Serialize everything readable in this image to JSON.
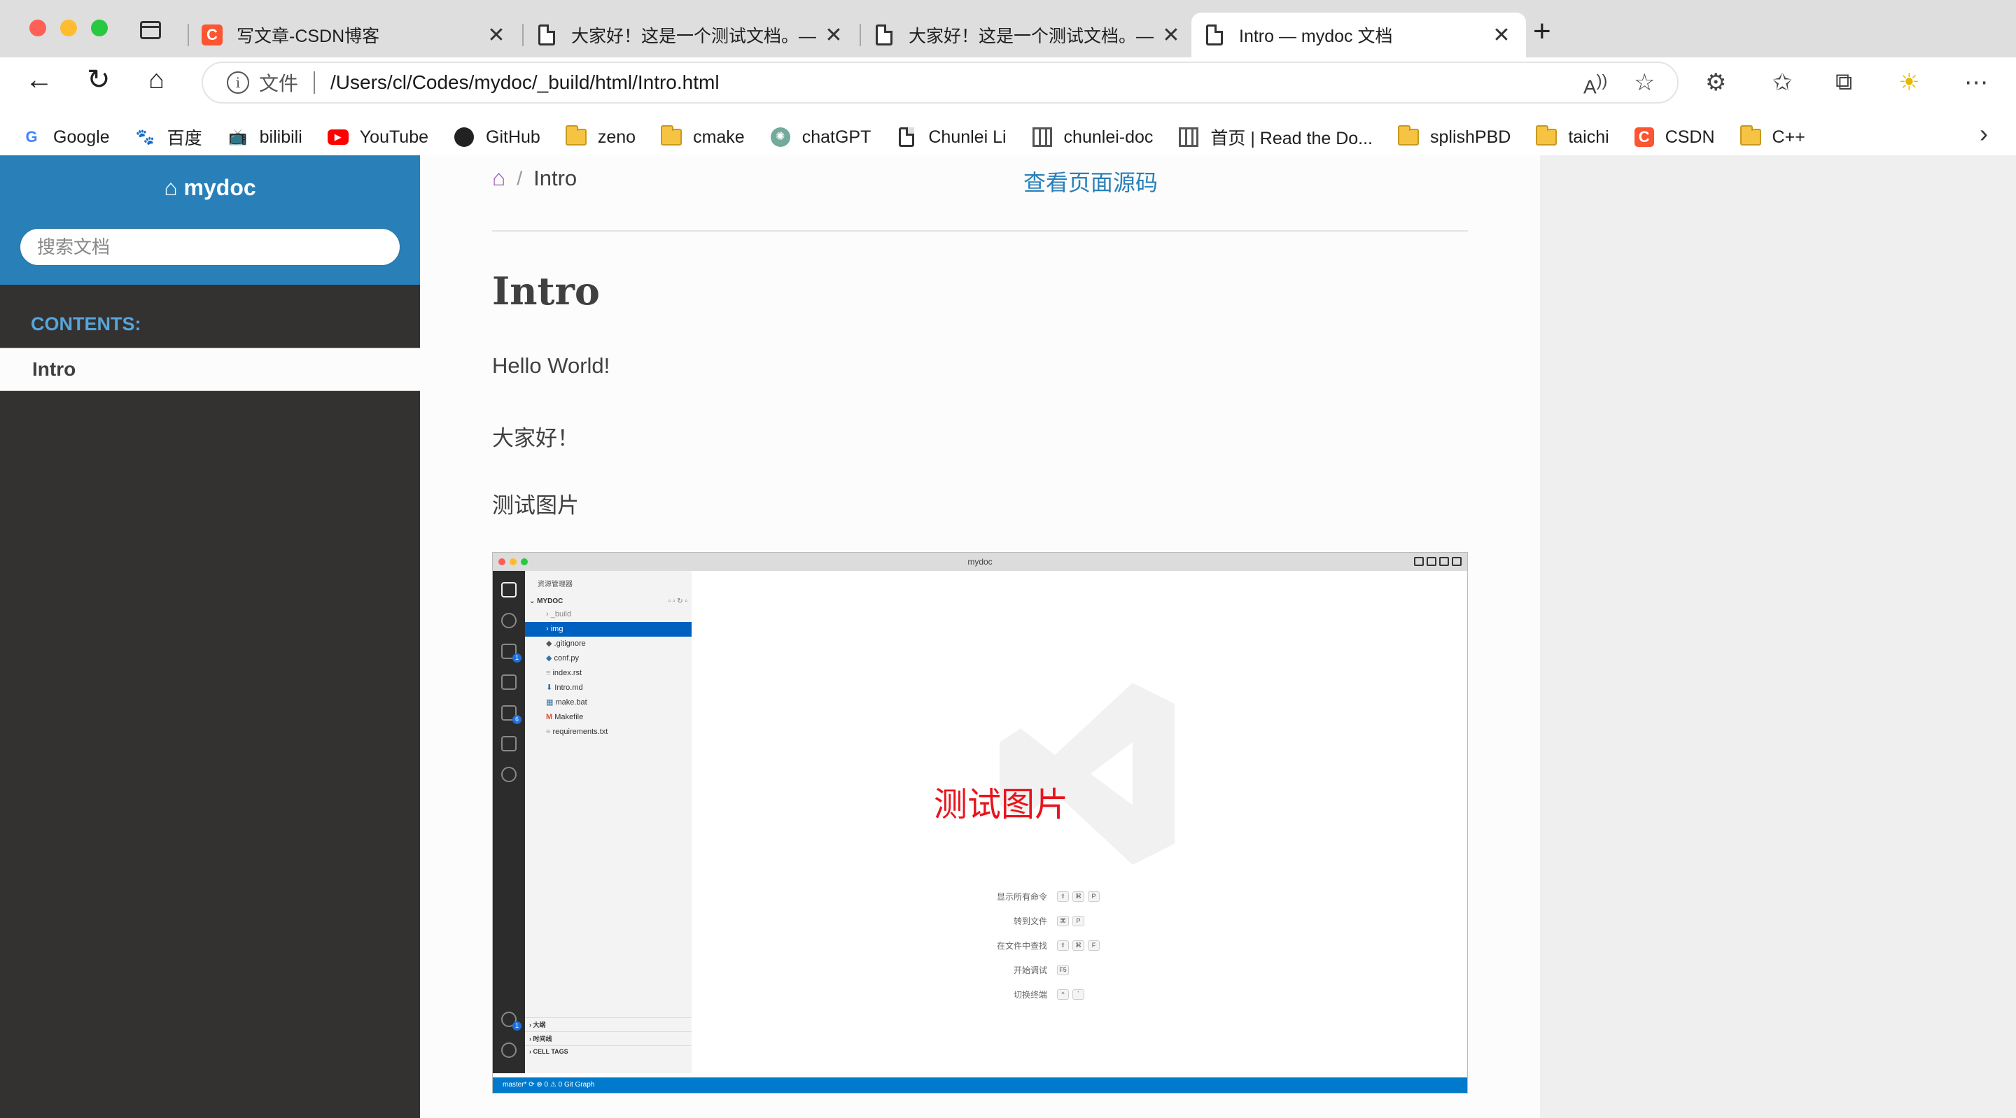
{
  "browser": {
    "tabs": [
      {
        "title": "写文章-CSDN博客",
        "favicon": "csdn-icon",
        "active": false
      },
      {
        "title": "大家好！这是一个测试文档。— ",
        "favicon": "document-icon",
        "active": false
      },
      {
        "title": "大家好！这是一个测试文档。— ",
        "favicon": "document-icon",
        "active": false
      },
      {
        "title": "Intro — mydoc 文档",
        "favicon": "document-icon",
        "active": true
      }
    ],
    "address": {
      "scheme_label": "文件",
      "path": "/Users/cl/Codes/mydoc/_build/html/Intro.html"
    },
    "bookmarks": [
      {
        "label": "Google",
        "icon": "google-icon"
      },
      {
        "label": "百度",
        "icon": "baidu-icon"
      },
      {
        "label": "bilibili",
        "icon": "bilibili-icon"
      },
      {
        "label": "YouTube",
        "icon": "youtube-icon"
      },
      {
        "label": "GitHub",
        "icon": "github-icon"
      },
      {
        "label": "zeno",
        "icon": "folder-icon"
      },
      {
        "label": "cmake",
        "icon": "folder-icon"
      },
      {
        "label": "chatGPT",
        "icon": "chatgpt-icon"
      },
      {
        "label": "Chunlei Li",
        "icon": "document-icon"
      },
      {
        "label": "chunlei-doc",
        "icon": "book-icon"
      },
      {
        "label": "首页 | Read the Do...",
        "icon": "book-icon"
      },
      {
        "label": "splishPBD",
        "icon": "folder-icon"
      },
      {
        "label": "taichi",
        "icon": "folder-icon"
      },
      {
        "label": "CSDN",
        "icon": "csdn-icon"
      },
      {
        "label": "C++",
        "icon": "folder-icon"
      }
    ]
  },
  "sidebar": {
    "project": "mydoc",
    "search_placeholder": "搜索文档",
    "caption": "CONTENTS:",
    "items": [
      {
        "label": "Intro",
        "current": true
      }
    ]
  },
  "content": {
    "breadcrumb": {
      "current": "Intro"
    },
    "view_source": "查看页面源码",
    "title": "Intro",
    "paragraphs": [
      "Hello World!",
      "大家好！",
      "测试图片"
    ],
    "image": {
      "window_title": "mydoc",
      "explorer_header": "资源管理器",
      "root": "MYDOC",
      "files": [
        "_build",
        "img",
        ".gitignore",
        "conf.py",
        "index.rst",
        "Intro.md",
        "make.bat",
        "Makefile",
        "requirements.txt"
      ],
      "selected_file": "img",
      "overlay_text": "测试图片",
      "shortcuts": [
        {
          "label": "显示所有命令",
          "keys": [
            "⇧",
            "⌘",
            "P"
          ]
        },
        {
          "label": "转到文件",
          "keys": [
            "⌘",
            "P"
          ]
        },
        {
          "label": "在文件中查找",
          "keys": [
            "⇧",
            "⌘",
            "F"
          ]
        },
        {
          "label": "开始调试",
          "keys": [
            "F5"
          ]
        },
        {
          "label": "切换终端",
          "keys": [
            "^",
            "`"
          ]
        }
      ],
      "bottom_sections": [
        "大纲",
        "时间线",
        "CELL TAGS"
      ],
      "statusbar": "master*   ⟳   ⊗ 0 ⚠ 0   Git Graph"
    }
  },
  "colors": {
    "sidebar_top": "#2980b9",
    "sidebar_bg": "#343131",
    "link": "#2980b9",
    "home_icon": "#9b59b6",
    "overlay_text": "#e8141b"
  }
}
